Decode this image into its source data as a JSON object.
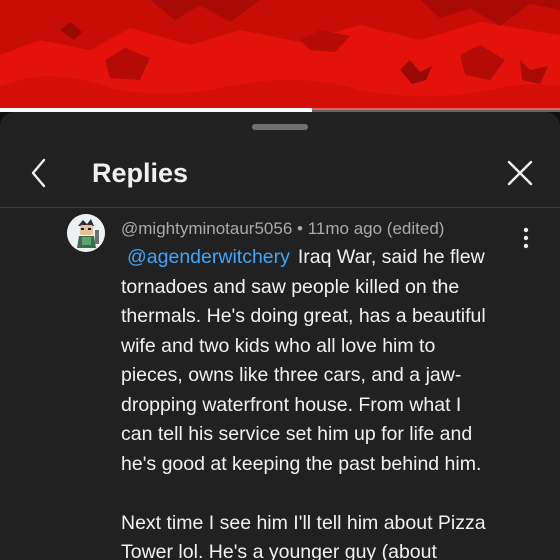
{
  "video": {
    "progress": 0.558,
    "colors": {
      "background": "#e3120a",
      "accent": "#b80c06"
    }
  },
  "progress_bar": {
    "icon": "progress-bar"
  },
  "sheet": {
    "title": "Replies",
    "back_icon": "chevron-left-icon",
    "close_icon": "close-icon"
  },
  "comment": {
    "author": "@mightyminotaur5056",
    "separator": "•",
    "time": "11mo ago (edited)",
    "mention": "@agenderwitchery",
    "lines": [
      "Iraq War, said he flew",
      "tornadoes and saw people killed on the",
      "thermals. He's doing great, has a beautiful",
      "wife and two kids who all love him to",
      "pieces, owns like three cars, and a jaw-",
      "dropping waterfront house. From what I",
      "can tell his service set him up for life and",
      "he's good at keeping the past behind him."
    ],
    "lines2": [
      "Next time I see him I'll tell him about Pizza",
      "Tower lol. He's a younger guy (about"
    ],
    "more_icon": "more-vert-icon",
    "colors": {
      "text": "#f1f1f1",
      "meta": "#aaaaaa",
      "mention": "#3ea6ff"
    }
  }
}
